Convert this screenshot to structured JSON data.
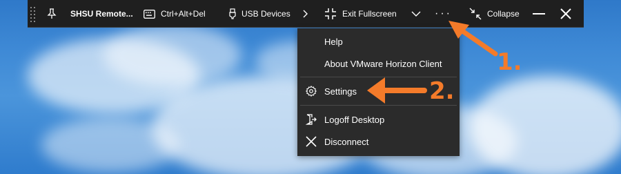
{
  "toolbar": {
    "title": "SHSU Remote...",
    "ctrl_alt_del_label": "Ctrl+Alt+Del",
    "usb_devices_label": "USB Devices",
    "exit_fullscreen_label": "Exit Fullscreen",
    "more_label": "···",
    "collapse_label": "Collapse"
  },
  "menu": {
    "items": [
      {
        "label": "Help"
      },
      {
        "label": "About VMware Horizon Client"
      },
      {
        "label": "Settings"
      },
      {
        "label": "Logoff Desktop"
      },
      {
        "label": "Disconnect"
      }
    ]
  },
  "annotations": {
    "step1": "1.",
    "step2": "2.",
    "color": "#f47b2a"
  },
  "colors": {
    "toolbar_bg": "#1f1f1f",
    "menu_bg": "#2b2b2b",
    "accent_annotation": "#f47b2a"
  },
  "icons": [
    "drag-grip-icon",
    "pin-icon",
    "keyboard-icon",
    "usb-icon",
    "chevron-right-icon",
    "exit-fullscreen-icon",
    "chevron-down-icon",
    "more-icon",
    "collapse-icon",
    "minimize-icon",
    "close-icon",
    "gear-icon",
    "logoff-icon",
    "disconnect-icon"
  ]
}
